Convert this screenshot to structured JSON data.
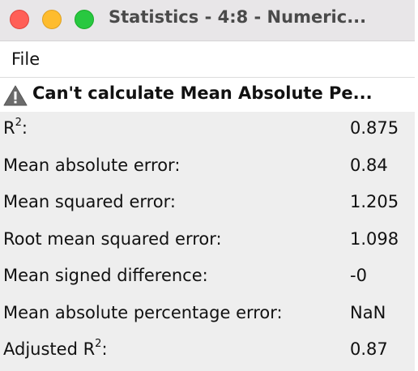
{
  "window": {
    "title": "Statistics - 4:8 - Numeric...",
    "buttons": [
      "close",
      "minimize",
      "maximize"
    ]
  },
  "menu": {
    "file_label": "File"
  },
  "warning": {
    "icon": "warning-triangle-icon",
    "text": "Can't calculate Mean Absolute Pe..."
  },
  "stats": {
    "r2_label_prefix": "R",
    "r2_sup": "2",
    "r2_label_suffix": ":",
    "r2_value": "0.875",
    "mae_label": "Mean absolute error:",
    "mae_value": "0.84",
    "mse_label": "Mean squared error:",
    "mse_value": "1.205",
    "rmse_label": "Root mean squared error:",
    "rmse_value": "1.098",
    "msd_label": "Mean signed difference:",
    "msd_value": "-0",
    "mape_label": "Mean absolute percentage error:",
    "mape_value": "NaN",
    "adj_r2_label_prefix": "Adjusted R",
    "adj_r2_sup": "2",
    "adj_r2_label_suffix": ":",
    "adj_r2_value": "0.87"
  },
  "colors": {
    "close": "#ff5f57",
    "minimize": "#febc2e",
    "maximize": "#28c840"
  }
}
